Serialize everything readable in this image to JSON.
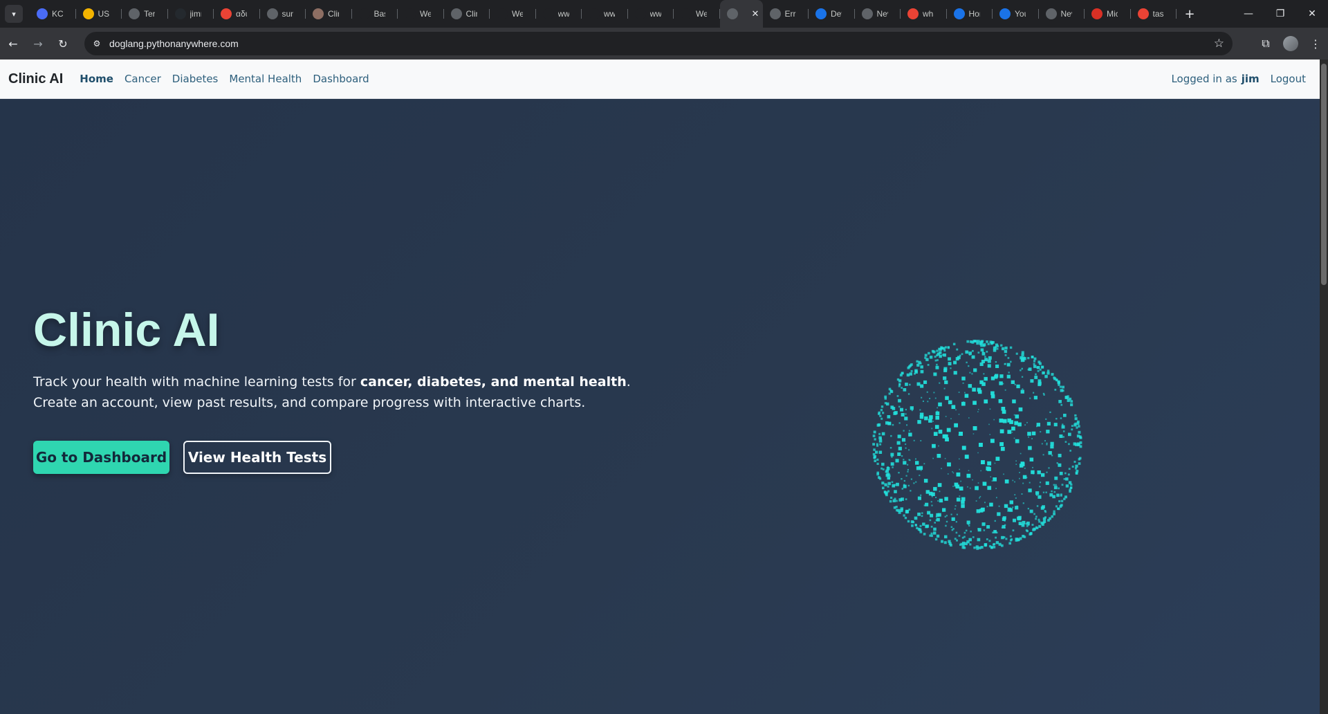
{
  "browser": {
    "tabs": [
      {
        "title": "KCD",
        "color": "#4a6cf7",
        "icon": "k8s-icon"
      },
      {
        "title": "US-",
        "color": "#f4b400",
        "icon": "drive-icon"
      },
      {
        "title": "Terr",
        "color": "#5f6368",
        "icon": "globe-icon"
      },
      {
        "title": "jimr",
        "color": "#24292e",
        "icon": "github-icon"
      },
      {
        "title": "αδυ",
        "color": "#ea4335",
        "icon": "google-icon"
      },
      {
        "title": "sun",
        "color": "#5f6368",
        "icon": "globe-icon"
      },
      {
        "title": "Clin",
        "color": "#8d6e63",
        "icon": "clinic-icon"
      },
      {
        "title": "Basi",
        "color": "#202124",
        "icon": "openai-icon"
      },
      {
        "title": "Wel",
        "color": "#202124",
        "icon": "openai-icon"
      },
      {
        "title": "Clin",
        "color": "#5f6368",
        "icon": "globe-icon"
      },
      {
        "title": "Wel",
        "color": "#202124",
        "icon": "openai-icon"
      },
      {
        "title": "ww",
        "color": "#202124",
        "icon": "openai-icon"
      },
      {
        "title": "ww",
        "color": "#202124",
        "icon": "openai-icon"
      },
      {
        "title": "ww",
        "color": "#202124",
        "icon": "openai-icon"
      },
      {
        "title": "We",
        "color": "#202124",
        "icon": "openai-icon"
      },
      {
        "title": "",
        "color": "#5f6368",
        "icon": "globe-icon",
        "active": true
      },
      {
        "title": "Erro",
        "color": "#5f6368",
        "icon": "gear-icon"
      },
      {
        "title": "Dev",
        "color": "#1a73e8",
        "icon": "d-icon"
      },
      {
        "title": "Nev",
        "color": "#5f6368",
        "icon": "globe-icon"
      },
      {
        "title": "wha",
        "color": "#ea4335",
        "icon": "google-icon"
      },
      {
        "title": "Hor",
        "color": "#1a73e8",
        "icon": "c-icon"
      },
      {
        "title": "You",
        "color": "#1a73e8",
        "icon": "c-icon"
      },
      {
        "title": "Nev",
        "color": "#5f6368",
        "icon": "globe-icon"
      },
      {
        "title": "Mic",
        "color": "#d93025",
        "icon": "copilot-icon"
      },
      {
        "title": "tasl",
        "color": "#ea4335",
        "icon": "google-icon"
      }
    ],
    "close_glyph": "✕",
    "new_tab": "+",
    "url": "doglang.pythonanywhere.com"
  },
  "site": {
    "brand": "Clinic AI",
    "nav": [
      "Home",
      "Cancer",
      "Diabetes",
      "Mental Health",
      "Dashboard"
    ],
    "active_nav": "Home",
    "logged_in_prefix": "Logged in as",
    "username": "jim",
    "logout": "Logout"
  },
  "hero": {
    "title": "Clinic AI",
    "line1_prefix": "Track your health with machine learning tests for ",
    "line1_bold": "cancer, diabetes, and mental health",
    "line1_suffix": ".",
    "line2": "Create an account, view past results, and compare progress with interactive charts.",
    "primary_button": "Go to Dashboard",
    "secondary_button": "View Health Tests",
    "sphere_color": "#22e0dc"
  }
}
